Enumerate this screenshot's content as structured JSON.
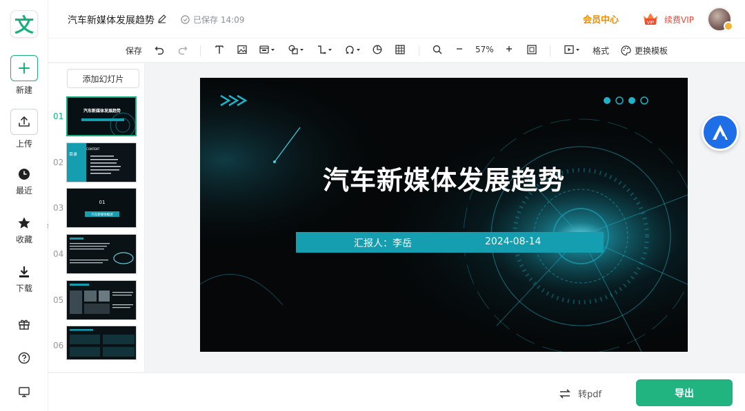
{
  "app": {
    "logo_char": "文"
  },
  "rail": {
    "items": [
      {
        "label": "新建",
        "icon": "plus-icon"
      },
      {
        "label": "上传",
        "icon": "upload-icon"
      },
      {
        "label": "最近",
        "icon": "clock-icon"
      },
      {
        "label": "收藏",
        "icon": "star-icon"
      },
      {
        "label": "下载",
        "icon": "download-icon"
      }
    ],
    "bottom_icons": [
      "gift-icon",
      "help-icon",
      "monitor-icon"
    ]
  },
  "header": {
    "doc_title": "汽车新媒体发展趋势",
    "saved_status": "已保存 14:09",
    "vip_center": "会员中心",
    "vip_badge_text": "VIP",
    "renew_vip": "续费VIP"
  },
  "toolbar": {
    "save": "保存",
    "zoom": "57%",
    "format": "格式",
    "change_template": "更换模板"
  },
  "panel": {
    "add_slide": "添加幻灯片",
    "slides": [
      {
        "num": "01",
        "active": true
      },
      {
        "num": "02",
        "active": false
      },
      {
        "num": "03",
        "active": false
      },
      {
        "num": "04",
        "active": false
      },
      {
        "num": "05",
        "active": false
      },
      {
        "num": "06",
        "active": false
      }
    ],
    "thumb_texts": {
      "t1_title": "汽车新媒体发展趋势",
      "t2_title": "目录",
      "t2_sub": "CONTENT",
      "t3_num": "01",
      "t3_title": "汽车新媒体概述"
    }
  },
  "slide": {
    "title": "汽车新媒体发展趋势",
    "reporter": "汇报人：李岳",
    "date": "2024-08-14"
  },
  "footer": {
    "to_pdf": "转pdf",
    "export": "导出"
  },
  "colors": {
    "brand_green": "#16b07c",
    "accent_teal": "#159db0",
    "vip_orange": "#f08c00",
    "export_green": "#21b481"
  }
}
